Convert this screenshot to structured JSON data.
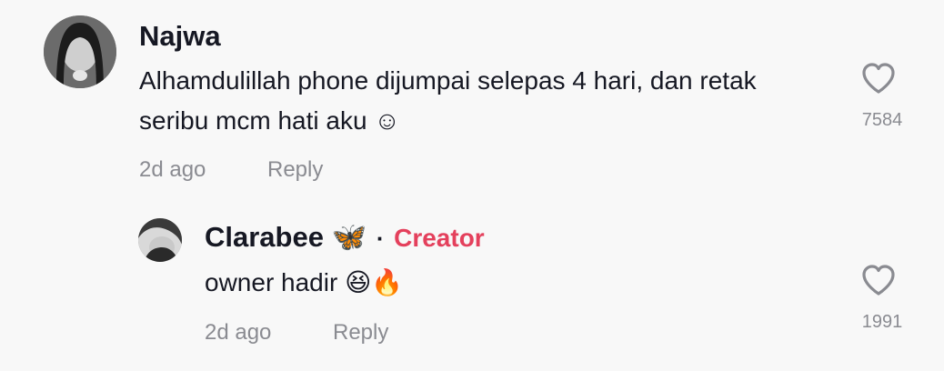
{
  "comment": {
    "author": "Najwa",
    "text": "Alhamdulillah phone dijumpai selepas 4 hari, dan retak seribu mcm hati aku ☺",
    "time": "2d ago",
    "reply_label": "Reply",
    "likes": "7584",
    "like_icon": "heart-outline-icon"
  },
  "reply": {
    "author": "Clarabee 🦋",
    "separator": "·",
    "badge": "Creator",
    "text": "owner hadir 😆🔥",
    "time": "2d ago",
    "reply_label": "Reply",
    "likes": "1991",
    "like_icon": "heart-outline-icon"
  },
  "colors": {
    "background": "#f8f8f8",
    "text": "#161823",
    "muted": "#8a8b91",
    "creator": "#e4405c"
  }
}
